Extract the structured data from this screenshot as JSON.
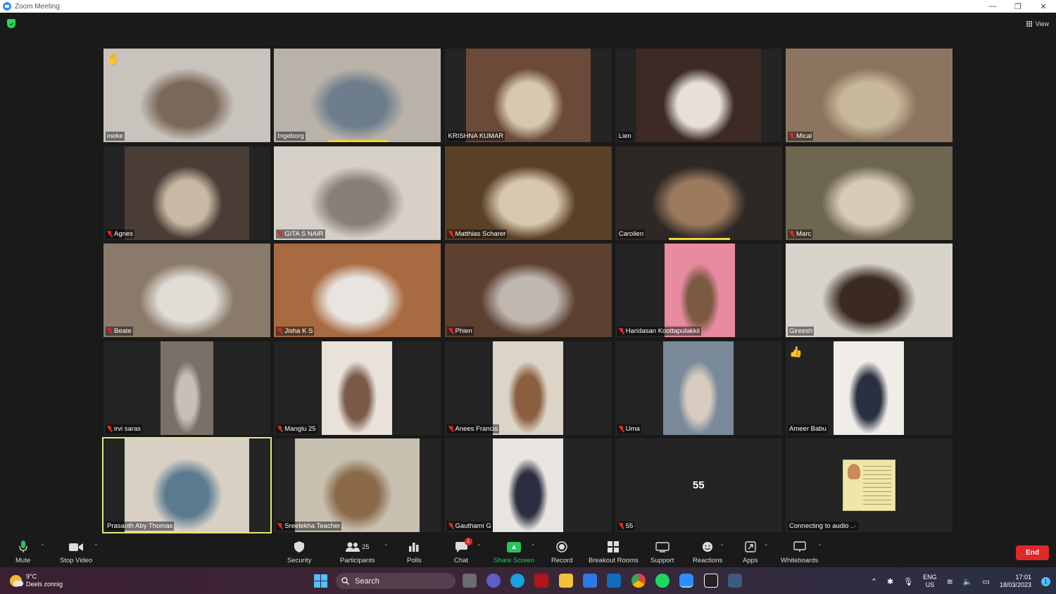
{
  "window": {
    "title": "Zoom Meeting",
    "minimize": "—",
    "restore": "❐",
    "close": "✕"
  },
  "header": {
    "view_label": "View"
  },
  "tiles": [
    {
      "name": "ineke",
      "muted": false,
      "emoji": "✋",
      "video": true
    },
    {
      "name": "Ingeborg",
      "muted": false,
      "speaking": true,
      "video": true
    },
    {
      "name": "KRISHNA KUMAR",
      "muted": false,
      "video": true
    },
    {
      "name": "Lien",
      "muted": false,
      "video": true
    },
    {
      "name": "Mical",
      "muted": true,
      "video": true
    },
    {
      "name": "Agnes",
      "muted": true,
      "video": true
    },
    {
      "name": "GITA S NAIR",
      "muted": true,
      "video": true
    },
    {
      "name": "Matthias Scharer",
      "muted": true,
      "video": true
    },
    {
      "name": "Carolien",
      "muted": false,
      "speaking": true,
      "video": true
    },
    {
      "name": "Marc",
      "muted": true,
      "video": true
    },
    {
      "name": "Beate",
      "muted": true,
      "video": true
    },
    {
      "name": "Jisha K S",
      "muted": true,
      "video": true
    },
    {
      "name": "Phien",
      "muted": true,
      "video": true
    },
    {
      "name": "Haridasan Koottapulakkil",
      "muted": true,
      "video": true
    },
    {
      "name": "Gireesh",
      "muted": false,
      "video": true
    },
    {
      "name": "irvi saras",
      "muted": true,
      "video": true
    },
    {
      "name": "Manglu 25",
      "muted": true,
      "video": true
    },
    {
      "name": "Anees Francis",
      "muted": true,
      "video": true
    },
    {
      "name": "Uma",
      "muted": true,
      "video": true
    },
    {
      "name": "Ameer Babu",
      "muted": false,
      "emoji": "👍",
      "video": true
    },
    {
      "name": "Prasanth Aby Thomas",
      "muted": false,
      "active": true,
      "video": true
    },
    {
      "name": "Sreelekha Teacher",
      "muted": true,
      "video": true
    },
    {
      "name": "Gauthami G",
      "muted": true,
      "video": true
    },
    {
      "name": "55",
      "muted": true,
      "video": false,
      "big_label": "55"
    },
    {
      "name": "Connecting to audio ..·",
      "muted": false,
      "video": false,
      "poster": true
    }
  ],
  "controls": {
    "mute": "Mute",
    "stop_video": "Stop Video",
    "security": "Security",
    "participants": "Participants",
    "participants_count": "25",
    "polls": "Polls",
    "chat": "Chat",
    "chat_badge": "1",
    "share_screen": "Share Screen",
    "record": "Record",
    "breakout_rooms": "Breakout Rooms",
    "support": "Support",
    "reactions": "Reactions",
    "apps": "Apps",
    "whiteboards": "Whiteboards",
    "end": "End"
  },
  "taskbar": {
    "weather_temp": "9°C",
    "weather_desc": "Deels zonnig",
    "search": "Search",
    "lang_top": "ENG",
    "lang_bottom": "US",
    "time": "17:01",
    "date": "18/03/2023",
    "notification_count": "1"
  },
  "colors": {
    "accent_green": "#23c55e",
    "end_red": "#e02828",
    "active_speaker_yellow": "#f2d43c",
    "zoom_blue": "#2d8cff"
  }
}
